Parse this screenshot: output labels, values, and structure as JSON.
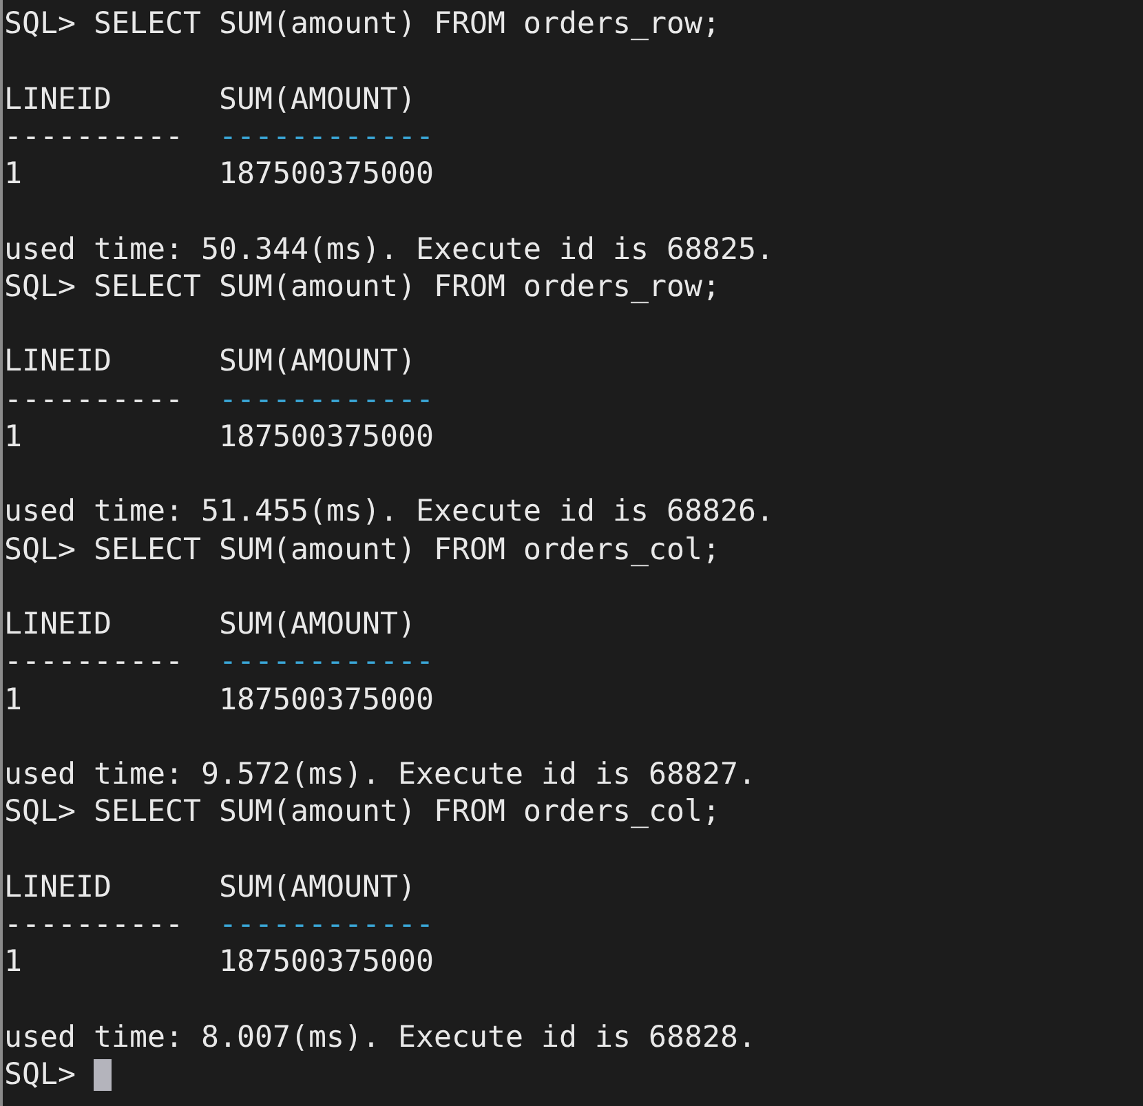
{
  "terminal": {
    "lines": [
      {
        "kind": "command",
        "text": "SQL> SELECT SUM(amount) FROM orders_row;"
      },
      {
        "kind": "blank"
      },
      {
        "kind": "header",
        "cells": [
          "LINEID",
          "SUM(AMOUNT)"
        ]
      },
      {
        "kind": "rule",
        "cells": [
          "----------",
          "------------"
        ]
      },
      {
        "kind": "row",
        "cells": [
          "1",
          "187500375000"
        ]
      },
      {
        "kind": "blank"
      },
      {
        "kind": "status",
        "text": "used time: 50.344(ms). Execute id is 68825."
      },
      {
        "kind": "command",
        "text": "SQL> SELECT SUM(amount) FROM orders_row;"
      },
      {
        "kind": "blank"
      },
      {
        "kind": "header",
        "cells": [
          "LINEID",
          "SUM(AMOUNT)"
        ]
      },
      {
        "kind": "rule",
        "cells": [
          "----------",
          "------------"
        ]
      },
      {
        "kind": "row",
        "cells": [
          "1",
          "187500375000"
        ]
      },
      {
        "kind": "blank"
      },
      {
        "kind": "status",
        "text": "used time: 51.455(ms). Execute id is 68826."
      },
      {
        "kind": "command",
        "text": "SQL> SELECT SUM(amount) FROM orders_col;"
      },
      {
        "kind": "blank"
      },
      {
        "kind": "header",
        "cells": [
          "LINEID",
          "SUM(AMOUNT)"
        ]
      },
      {
        "kind": "rule",
        "cells": [
          "----------",
          "------------"
        ]
      },
      {
        "kind": "row",
        "cells": [
          "1",
          "187500375000"
        ]
      },
      {
        "kind": "blank"
      },
      {
        "kind": "status",
        "text": "used time: 9.572(ms). Execute id is 68827."
      },
      {
        "kind": "command",
        "text": "SQL> SELECT SUM(amount) FROM orders_col;"
      },
      {
        "kind": "blank"
      },
      {
        "kind": "header",
        "cells": [
          "LINEID",
          "SUM(AMOUNT)"
        ]
      },
      {
        "kind": "rule",
        "cells": [
          "----------",
          "------------"
        ]
      },
      {
        "kind": "row",
        "cells": [
          "1",
          "187500375000"
        ]
      },
      {
        "kind": "blank"
      },
      {
        "kind": "status",
        "text": "used time: 8.007(ms). Execute id is 68828."
      },
      {
        "kind": "prompt",
        "text": "SQL>",
        "cursor": true
      }
    ]
  }
}
